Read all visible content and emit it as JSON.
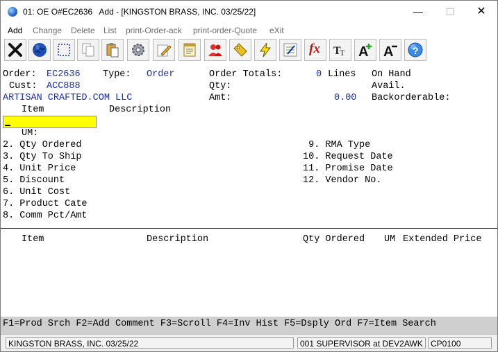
{
  "window": {
    "title": "01: OE O#EC2636   Add - [KINGSTON BRASS, INC. 03/25/22]",
    "minimize": "—",
    "maximize": "☐",
    "close": "✕"
  },
  "menu": [
    "Add",
    "Change",
    "Delete",
    "List",
    "print-Order-ack",
    "print-order-Quote",
    "eXit"
  ],
  "toolbar": {
    "icons": [
      "exit-x-icon",
      "globe-icon",
      "select-box-icon",
      "copy-icon",
      "paste-icon",
      "settings-gear-icon",
      "edit-pencil-icon",
      "notepad-icon",
      "users-icon",
      "tag-icon",
      "lightning-icon",
      "calculator-icon",
      "function-fx-icon",
      "font-type-icon",
      "font-increase-icon",
      "font-decrease-icon",
      "help-icon"
    ],
    "fx_label": "fx"
  },
  "header": {
    "order_label": "Order:",
    "order_value": "EC2636",
    "type_label": "Type:",
    "type_value": "Order",
    "totals_label": "Order Totals:",
    "lines_count": "0",
    "lines_label": "Lines",
    "on_hand_label": "On Hand",
    "cust_label": "Cust:",
    "cust_value": "ACC888",
    "qty_label": "Qty:",
    "avail_label": "Avail.",
    "customer_name": "ARTISAN CRAFTED.COM LLC",
    "amt_label": "Amt:",
    "amt_value": "0.00",
    "backorderable_label": "Backorderable:"
  },
  "entry": {
    "item_label": "Item",
    "description_label": "Description",
    "um_label": "UM:"
  },
  "fields_left": [
    "2. Qty Ordered",
    "3. Qty To Ship",
    "4. Unit Price",
    "5. Discount",
    "6. Unit Cost",
    "7. Product Cate",
    "8. Comm Pct/Amt"
  ],
  "fields_right": [
    " 9. RMA Type",
    "10. Request Date",
    "11. Promise Date",
    "12. Vendor No."
  ],
  "lines_table": {
    "columns": [
      "Item",
      "Description",
      "Qty Ordered",
      "UM",
      "Extended Price"
    ]
  },
  "fkeys": "F1=Prod Srch F2=Add Comment F3=Scroll F4=Inv Hist F5=Dsply Ord F7=Item Search",
  "status": {
    "company": "KINGSTON BRASS, INC. 03/25/22",
    "user": "001 SUPERVISOR at DEV2AWK",
    "program": "CP0100"
  },
  "colors": {
    "accent_blue": "#1a2db5",
    "input_highlight": "#ffff00",
    "fkey_bar": "#cfcfcf"
  }
}
